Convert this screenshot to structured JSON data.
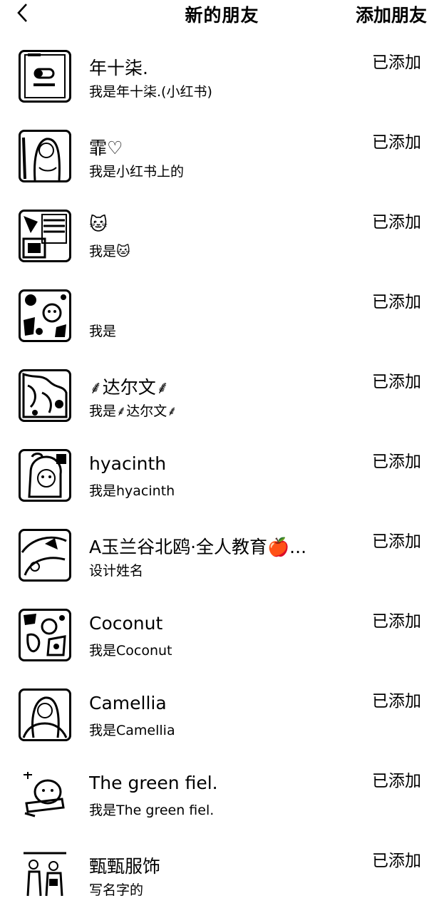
{
  "header": {
    "title": "新的朋友",
    "action_label": "添加朋友",
    "back_icon": "chevron-left-icon"
  },
  "friends": [
    {
      "name": "年十柒.",
      "sub": "我是年十柒.(小红书)",
      "status": "已添加"
    },
    {
      "name": "霏♡",
      "sub": "我是小红书上的",
      "status": "已添加"
    },
    {
      "name": "🐱",
      "sub": "我是🐱",
      "status": "已添加"
    },
    {
      "name": "",
      "sub": "我是",
      "status": "已添加"
    },
    {
      "name": "⸙达尔文⸙",
      "sub": "我是⸙达尔文⸙",
      "status": "已添加"
    },
    {
      "name": "hyacinth",
      "sub": "我是hyacinth",
      "status": "已添加"
    },
    {
      "name": "A玉兰谷北鸥·全人教育🍎...",
      "sub": "设计姓名",
      "status": "已添加"
    },
    {
      "name": "Coconut",
      "sub": "我是Coconut",
      "status": "已添加"
    },
    {
      "name": "Camellia",
      "sub": "我是Camellia",
      "status": "已添加"
    },
    {
      "name": "The green fiel.",
      "sub": "我是The green fiel.",
      "status": "已添加"
    },
    {
      "name": "甄甄服饰",
      "sub": "写名字的",
      "status": "已添加"
    }
  ]
}
